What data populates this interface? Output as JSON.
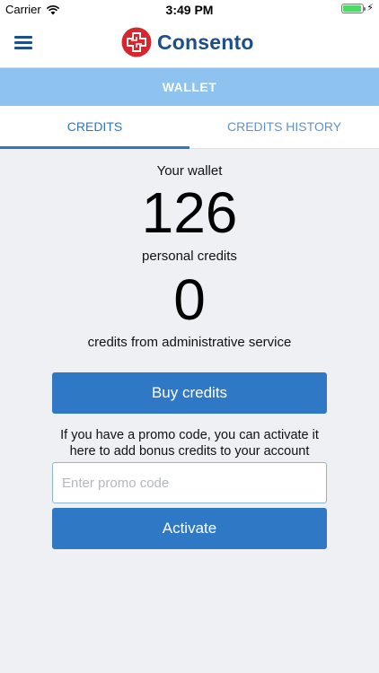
{
  "status_bar": {
    "carrier": "Carrier",
    "time": "3:49 PM",
    "wifi_icon": "wifi-icon",
    "battery_icon": "battery-icon",
    "charging_icon": "charging-bolt-icon"
  },
  "header": {
    "menu_icon": "hamburger-menu-icon",
    "logo_icon": "medical-cross-logo-icon",
    "brand_name": "Consento"
  },
  "section": {
    "title": "WALLET"
  },
  "tabs": [
    {
      "label": "CREDITS",
      "active": true
    },
    {
      "label": "CREDITS HISTORY",
      "active": false
    }
  ],
  "wallet": {
    "title": "Your wallet",
    "personal_credits": "126",
    "personal_label": "personal credits",
    "admin_credits": "0",
    "admin_label": "credits from administrative service"
  },
  "actions": {
    "buy_label": "Buy credits",
    "promo_text": "If you have a promo code, you can activate it here to add bonus credits to your account",
    "promo_placeholder": "Enter promo code",
    "promo_value": "",
    "activate_label": "Activate"
  },
  "colors": {
    "accent": "#2f78c6",
    "section_bar": "#8ec3ef",
    "brand": "#1d4e8a",
    "logo_red": "#d7262e",
    "background": "#eef0f4"
  }
}
